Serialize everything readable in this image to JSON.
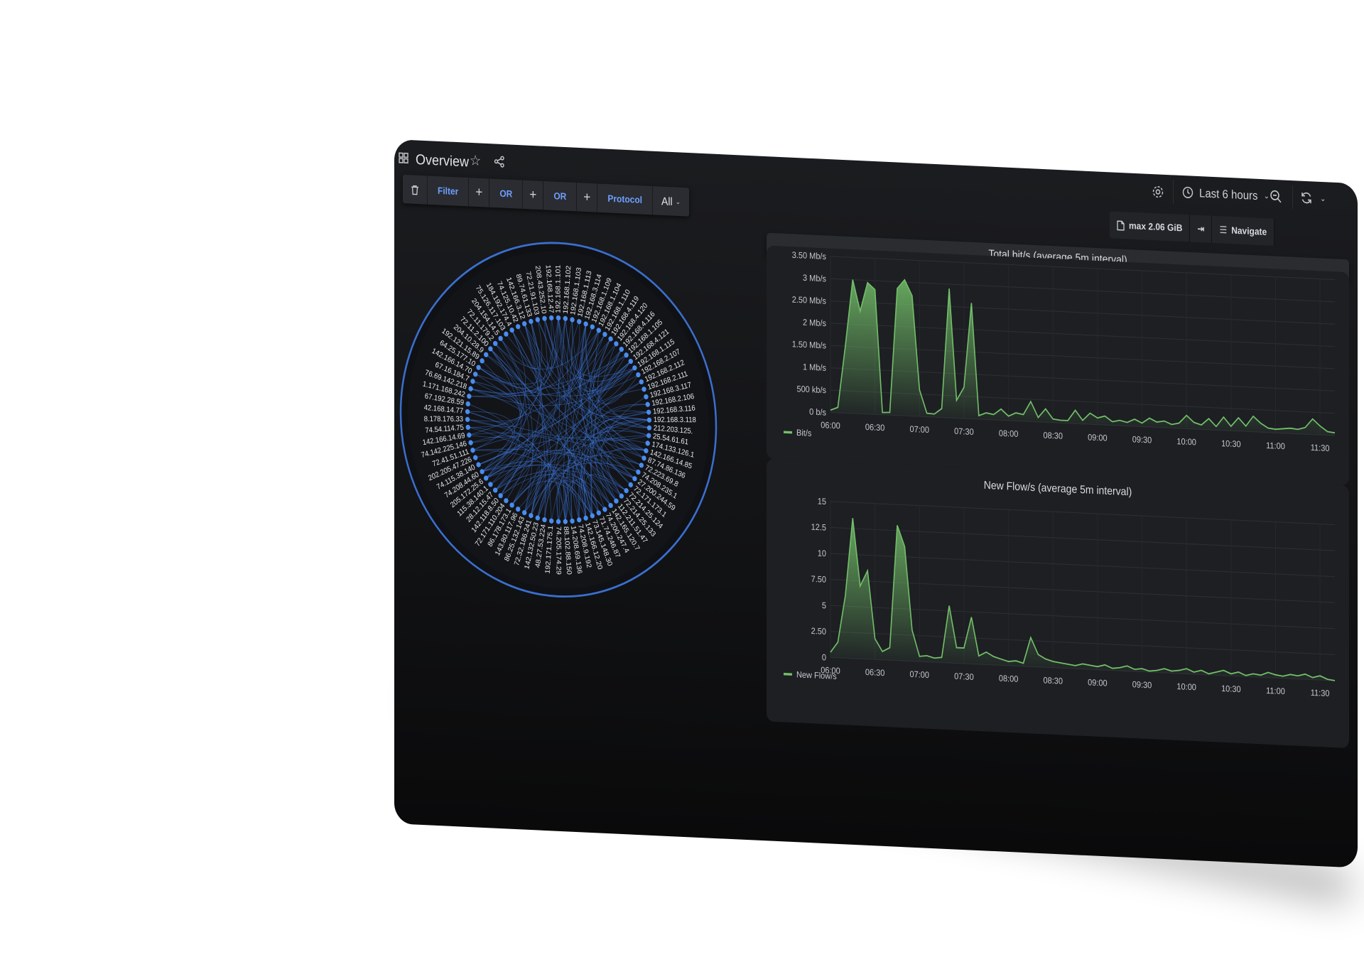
{
  "topbar": {
    "title": "Overview",
    "time_range": "Last 6 hours"
  },
  "filterbar": {
    "items": [
      "Filter",
      "OR",
      "OR",
      "Protocol"
    ],
    "select_value": "All"
  },
  "toolbar_right": {
    "max_label": "max 2.06 GiB",
    "navigate_label": "Navigate"
  },
  "chord": {
    "labels": [
      "192.168.1.101",
      "192.168.1.102",
      "192.168.1.103",
      "192.168.1.113",
      "192.168.3.114",
      "192.168.1.109",
      "192.168.1.104",
      "192.168.1.110",
      "192.168.4.119",
      "192.168.4.120",
      "192.168.4.116",
      "192.168.1.105",
      "192.168.4.121",
      "192.168.1.115",
      "192.168.2.107",
      "192.168.2.112",
      "192.168.2.111",
      "192.168.3.117",
      "192.168.2.106",
      "192.168.3.116",
      "192.168.3.118",
      "212.203.125.",
      "25.54.61.61",
      "174.133.126.1",
      "142.166.14.85",
      "87.74.86.136",
      "72.223.69.8",
      "74.208.235.1",
      "27.200.244.59",
      "72.171.173.1",
      "72.214.25.124",
      "72.214.25.133",
      "112.211.51.47",
      "142.165.120.7",
      "74.200.247.4",
      "71.74.246.87",
      "73.145.148.30",
      "142.166.12.20",
      "74.208.9.192",
      "14.208.69.136",
      "88.102.88.150",
      "74.205.174.29",
      "192.171.175.1",
      "48.27.53.224",
      "142.132.50.23",
      "72.32.186.241",
      "86.25.132.143",
      "143.80.117.96",
      "86.178.173.1",
      "72.171.110.204",
      "142.118.8.50",
      "28.12.15.47",
      "115.38.140.1",
      "205.172.25.6",
      "74.208.44.60",
      "74.115.38.140",
      "202.205.47.226",
      "72.41.51.111",
      "74.142.225.146",
      "142.166.14.69",
      "74.54.114.75",
      "8.178.176.33",
      "42.168.14.77",
      "67.192.28.59",
      "1.171.168.242",
      "76.69.142.218",
      "67.16.184.7",
      "142.166.14.70",
      "64.25.177.10",
      "192.121.15.89",
      "204.10.28.9",
      "72.11.2.100",
      "72.11.179.2",
      "204.154.14.5",
      "75.126.117.103",
      "184.192.174.4",
      "74.125.10.42",
      "142.166.3.12",
      "89.74.61.133",
      "72.21.91.103",
      "208.43.252.10",
      "192.168.12.47"
    ]
  },
  "charts": {
    "bitrate": {
      "title": "Total bit/s (average 5m interval)",
      "legend": "Bit/s",
      "color": "#73bf69",
      "y_ticks": [
        "3.50 Mb/s",
        "3 Mb/s",
        "2.50 Mb/s",
        "2 Mb/s",
        "1.50 Mb/s",
        "1 Mb/s",
        "500 kb/s",
        "0 b/s"
      ],
      "x_ticks": [
        "06:00",
        "06:30",
        "07:00",
        "07:30",
        "08:00",
        "08:30",
        "09:00",
        "09:30",
        "10:00",
        "10:30",
        "11:00",
        "11:30"
      ]
    },
    "flows": {
      "title": "New Flow/s (average 5m interval)",
      "legend": "New Flow/s",
      "color": "#73bf69",
      "y_ticks": [
        "15",
        "12.5",
        "10",
        "7.50",
        "5",
        "2.50",
        "0"
      ],
      "x_ticks": [
        "06:00",
        "06:30",
        "07:00",
        "07:30",
        "08:00",
        "08:30",
        "09:00",
        "09:30",
        "10:00",
        "10:30",
        "11:00",
        "11:30"
      ]
    }
  },
  "chart_data": [
    {
      "type": "area",
      "title": "Total bit/s (average 5m interval)",
      "ylabel": "",
      "y_unit": "b/s",
      "ylim": [
        0,
        3500000
      ],
      "series": [
        {
          "name": "Bit/s",
          "x": [
            "06:00",
            "06:05",
            "06:10",
            "06:15",
            "06:20",
            "06:25",
            "06:30",
            "06:35",
            "06:40",
            "06:45",
            "06:50",
            "06:55",
            "07:00",
            "07:05",
            "07:10",
            "07:15",
            "07:20",
            "07:25",
            "07:30",
            "07:35",
            "07:40",
            "07:45",
            "07:50",
            "07:55",
            "08:00",
            "08:05",
            "08:10",
            "08:15",
            "08:20",
            "08:25",
            "08:30",
            "08:35",
            "08:40",
            "08:45",
            "08:50",
            "08:55",
            "09:00",
            "09:05",
            "09:10",
            "09:15",
            "09:20",
            "09:25",
            "09:30",
            "09:35",
            "09:40",
            "09:45",
            "09:50",
            "09:55",
            "10:00",
            "10:05",
            "10:10",
            "10:15",
            "10:20",
            "10:25",
            "10:30",
            "10:35",
            "10:40",
            "10:45",
            "10:50",
            "10:55",
            "11:00",
            "11:05",
            "11:10",
            "11:15",
            "11:20",
            "11:25",
            "11:30",
            "11:35",
            "11:40"
          ],
          "values": [
            50000,
            120000,
            1500000,
            3000000,
            2300000,
            2950000,
            2800000,
            50000,
            60000,
            2850000,
            3050000,
            2700000,
            600000,
            80000,
            70000,
            200000,
            2900000,
            400000,
            700000,
            2600000,
            80000,
            150000,
            120000,
            250000,
            100000,
            180000,
            150000,
            450000,
            100000,
            300000,
            80000,
            60000,
            60000,
            300000,
            80000,
            250000,
            150000,
            200000,
            80000,
            120000,
            80000,
            160000,
            80000,
            200000,
            120000,
            150000,
            80000,
            120000,
            300000,
            150000,
            100000,
            250000,
            80000,
            300000,
            100000,
            300000,
            120000,
            350000,
            200000,
            100000,
            80000,
            100000,
            120000,
            100000,
            150000,
            350000,
            200000,
            80000,
            60000
          ]
        }
      ]
    },
    {
      "type": "area",
      "title": "New Flow/s (average 5m interval)",
      "ylabel": "",
      "ylim": [
        0,
        15
      ],
      "series": [
        {
          "name": "New Flow/s",
          "x": [
            "06:00",
            "06:05",
            "06:10",
            "06:15",
            "06:20",
            "06:25",
            "06:30",
            "06:35",
            "06:40",
            "06:45",
            "06:50",
            "06:55",
            "07:00",
            "07:05",
            "07:10",
            "07:15",
            "07:20",
            "07:25",
            "07:30",
            "07:35",
            "07:40",
            "07:45",
            "07:50",
            "07:55",
            "08:00",
            "08:05",
            "08:10",
            "08:15",
            "08:20",
            "08:25",
            "08:30",
            "08:35",
            "08:40",
            "08:45",
            "08:50",
            "08:55",
            "09:00",
            "09:05",
            "09:10",
            "09:15",
            "09:20",
            "09:25",
            "09:30",
            "09:35",
            "09:40",
            "09:45",
            "09:50",
            "09:55",
            "10:00",
            "10:05",
            "10:10",
            "10:15",
            "10:20",
            "10:25",
            "10:30",
            "10:35",
            "10:40",
            "10:45",
            "10:50",
            "10:55",
            "11:00",
            "11:05",
            "11:10",
            "11:15",
            "11:20",
            "11:25",
            "11:30",
            "11:35",
            "11:40"
          ],
          "values": [
            0.5,
            1.5,
            6,
            13.5,
            7,
            8.5,
            2,
            0.8,
            1.2,
            13,
            11,
            3,
            0.5,
            0.6,
            0.4,
            0.5,
            5.5,
            1.5,
            1.5,
            4.5,
            0.8,
            1.2,
            0.8,
            0.6,
            0.4,
            0.5,
            0.3,
            2.8,
            1.2,
            0.8,
            0.6,
            0.5,
            0.4,
            0.3,
            0.5,
            0.4,
            0.3,
            0.5,
            0.2,
            0.3,
            0.5,
            0.2,
            0.3,
            0.1,
            0.2,
            0.4,
            0.2,
            0.3,
            0.5,
            0.2,
            0.4,
            0.1,
            0.3,
            0.5,
            0.2,
            0.4,
            0.1,
            0.3,
            0.2,
            0.5,
            0.3,
            0.2,
            0.4,
            0.3,
            0.5,
            0.2,
            0.4,
            0.1,
            -1.0
          ]
        }
      ]
    }
  ]
}
